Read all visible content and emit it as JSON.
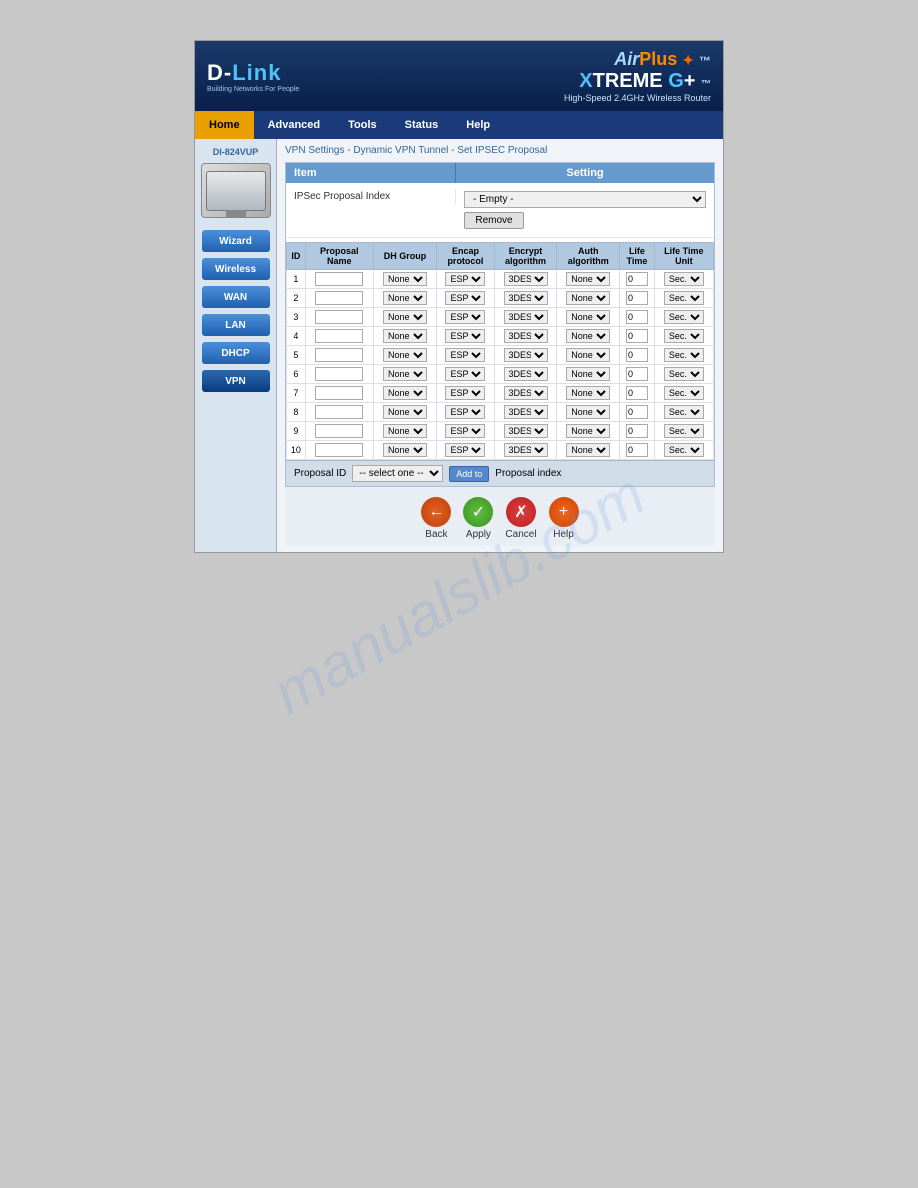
{
  "header": {
    "brand": "D-Link",
    "tagline": "Building Networks For People",
    "product_line": "AirPlus",
    "product_series": "XTREME G+",
    "product_desc": "High-Speed 2.4GHz Wireless Router"
  },
  "navbar": {
    "items": [
      {
        "label": "Home",
        "active": true
      },
      {
        "label": "Advanced",
        "active": false
      },
      {
        "label": "Tools",
        "active": false
      },
      {
        "label": "Status",
        "active": false
      },
      {
        "label": "Help",
        "active": false
      }
    ]
  },
  "sidebar": {
    "device_model": "DI-824VUP",
    "buttons": [
      {
        "label": "Wizard"
      },
      {
        "label": "Wireless"
      },
      {
        "label": "WAN"
      },
      {
        "label": "LAN"
      },
      {
        "label": "DHCP"
      },
      {
        "label": "VPN"
      }
    ]
  },
  "breadcrumb": "VPN Settings - Dynamic VPN Tunnel - Set IPSEC Proposal",
  "settings_table": {
    "headers": [
      "Item",
      "Setting"
    ],
    "ipsec_label": "IPSec Proposal Index",
    "ipsec_select_default": "- Empty -",
    "remove_btn": "Remove"
  },
  "proposal_table": {
    "headers": [
      "ID",
      "Proposal Name",
      "DH Group",
      "Encap protocol",
      "Encrypt algorithm",
      "Auth algorithm",
      "Life Time",
      "Life Time Unit"
    ],
    "rows": [
      {
        "id": "1",
        "dh": "None",
        "encap": "ESP",
        "encrypt": "3DES",
        "auth": "None",
        "lifetime": "0",
        "unit": "Sec."
      },
      {
        "id": "2",
        "dh": "None",
        "encap": "ESP",
        "encrypt": "3DES",
        "auth": "None",
        "lifetime": "0",
        "unit": "Sec."
      },
      {
        "id": "3",
        "dh": "None",
        "encap": "ESP",
        "encrypt": "3DES",
        "auth": "None",
        "lifetime": "0",
        "unit": "Sec."
      },
      {
        "id": "4",
        "dh": "None",
        "encap": "ESP",
        "encrypt": "3DES",
        "auth": "None",
        "lifetime": "0",
        "unit": "Sec."
      },
      {
        "id": "5",
        "dh": "None",
        "encap": "ESP",
        "encrypt": "3DES",
        "auth": "None",
        "lifetime": "0",
        "unit": "Sec."
      },
      {
        "id": "6",
        "dh": "None",
        "encap": "ESP",
        "encrypt": "3DES",
        "auth": "None",
        "lifetime": "0",
        "unit": "Sec."
      },
      {
        "id": "7",
        "dh": "None",
        "encap": "ESP",
        "encrypt": "3DES",
        "auth": "None",
        "lifetime": "0",
        "unit": "Sec."
      },
      {
        "id": "8",
        "dh": "None",
        "encap": "ESP",
        "encrypt": "3DES",
        "auth": "None",
        "lifetime": "0",
        "unit": "Sec."
      },
      {
        "id": "9",
        "dh": "None",
        "encap": "ESP",
        "encrypt": "3DES",
        "auth": "None",
        "lifetime": "0",
        "unit": "Sec."
      },
      {
        "id": "10",
        "dh": "None",
        "encap": "ESP",
        "encrypt": "3DES",
        "auth": "None",
        "lifetime": "0",
        "unit": "Sec."
      }
    ]
  },
  "bottom_bar": {
    "proposal_id_label": "Proposal ID",
    "select_default": "-- select one --",
    "add_to_btn": "Add to",
    "proposal_index_label": "Proposal index"
  },
  "actions": {
    "back_label": "Back",
    "apply_label": "Apply",
    "cancel_label": "Cancel",
    "help_label": "Help"
  },
  "watermark": "manualslib.com"
}
